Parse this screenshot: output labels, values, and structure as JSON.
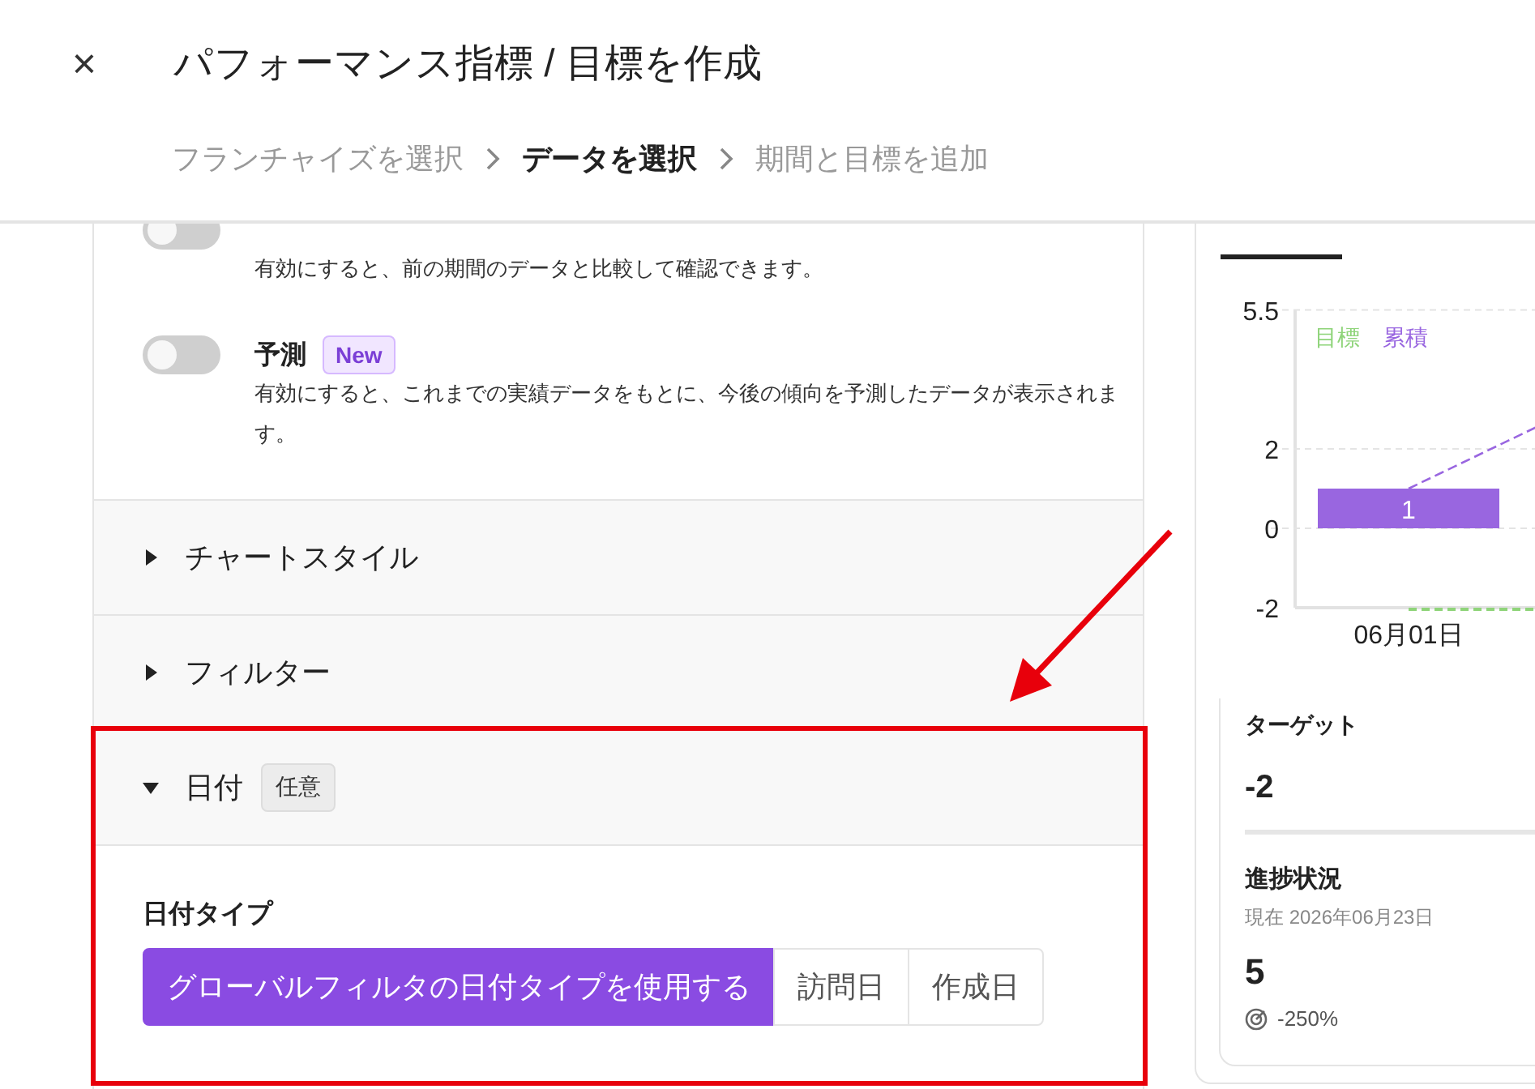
{
  "header": {
    "close": "×",
    "title": "パフォーマンス指標 / 目標を作成"
  },
  "steps": [
    {
      "label": "フランチャイズを選択",
      "selected": false
    },
    {
      "label": "データを選択",
      "selected": true
    },
    {
      "label": "期間と目標を追加",
      "selected": false
    }
  ],
  "options": [
    {
      "on": false,
      "description": "有効にすると、前の期間のデータと比較して確認できます。"
    },
    {
      "title": "予測",
      "badge": "New",
      "on": false,
      "description": "有効にすると、これまでの実績データをもとに、今後の傾向を予測したデータが表示されます。"
    }
  ],
  "sections": [
    {
      "title": "チャートスタイル",
      "expanded": false
    },
    {
      "title": "フィルター",
      "expanded": false
    },
    {
      "title": "日付",
      "badge": "任意",
      "expanded": true,
      "field_label": "日付タイプ",
      "choices": [
        {
          "label": "グローバルフィルタの日付タイプを使用する",
          "selected": true
        },
        {
          "label": "訪問日",
          "selected": false
        },
        {
          "label": "作成日",
          "selected": false
        }
      ]
    }
  ],
  "preview": {
    "chart_data": {
      "type": "bar",
      "categories": [
        "06月01日"
      ],
      "series": [
        {
          "name": "目標",
          "color": "#8fd47a",
          "values": [
            null
          ]
        },
        {
          "name": "累積",
          "color": "#9966e0",
          "values": [
            1
          ]
        }
      ],
      "ylim": [
        -2,
        5.5
      ],
      "yticks": [
        -2,
        0,
        2,
        5.5
      ],
      "data_labels": true,
      "ref_lines": [
        {
          "axis": "y",
          "value": -2,
          "color": "#8fd47a"
        }
      ]
    },
    "target": {
      "label": "ターゲット",
      "value": "-2"
    },
    "progress": {
      "label": "進捗状況",
      "date": "現在 2026年06月23日",
      "value": "5",
      "change": "-250%"
    }
  },
  "highlight": {
    "color": "#e8000b"
  }
}
